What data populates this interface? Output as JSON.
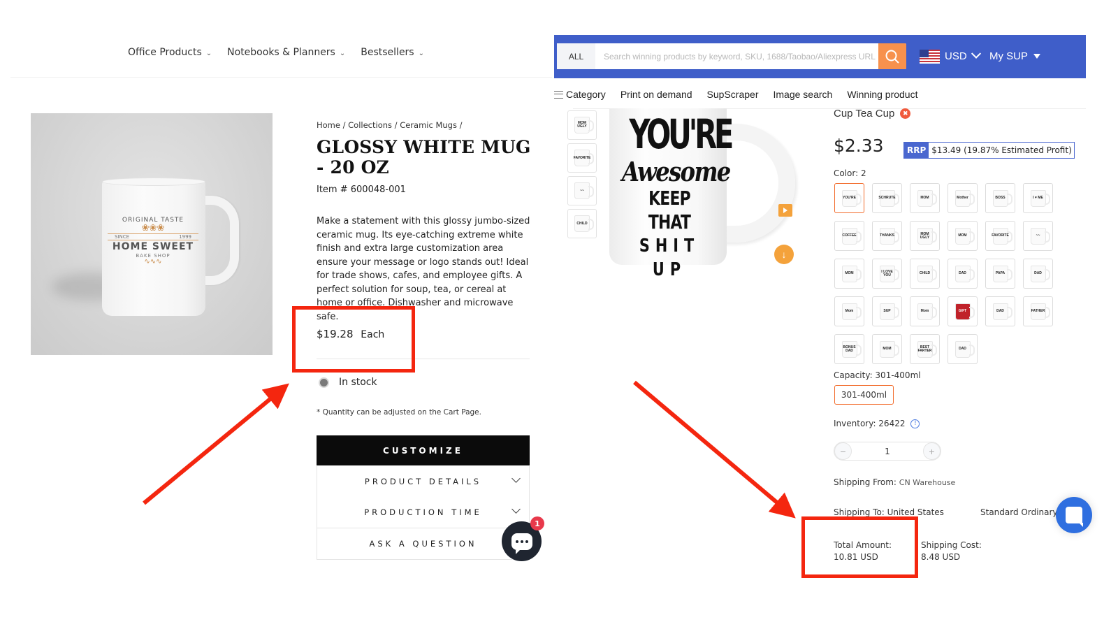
{
  "left_store": {
    "nav": [
      {
        "label": "Office Products"
      },
      {
        "label": "Notebooks & Planners"
      },
      {
        "label": "Bestsellers"
      }
    ],
    "hero_image": {
      "alt": "White mug with Home Sweet bake shop logo",
      "logo_top": "ORIGINAL TASTE",
      "logo_since": "SINCE",
      "logo_year": "1999",
      "logo_main": "HOME SWEET",
      "logo_sub": "BAKE SHOP"
    },
    "breadcrumb": "Home / Collections / Ceramic Mugs /",
    "title": "GLOSSY WHITE MUG - 20 OZ",
    "item_number": "Item # 600048-001",
    "description": "Make a statement with this glossy jumbo-sized ceramic mug. Its eye-catching extreme white finish and extra large customization area ensure your message or logo stands out! Ideal for trade shows, cafes, and employee gifts. A perfect solution for soup, tea, or cereal at home or office. Dishwasher and microwave safe.",
    "price": "$19.28",
    "price_unit": "Each",
    "stock_status": "In stock",
    "quantity_note": "* Quantity can be adjusted on the Cart Page.",
    "customize_label": "CUSTOMIZE",
    "accordions": [
      {
        "label": "PRODUCT DETAILS"
      },
      {
        "label": "PRODUCTION TIME"
      },
      {
        "label": "ASK A QUESTION"
      }
    ],
    "chat_badge_count": "1"
  },
  "supplier": {
    "search": {
      "scope": "ALL",
      "placeholder": "Search winning products by keyword, SKU, 1688/Taobao/Aliexpress URL",
      "value": ""
    },
    "currency": "USD",
    "account_menu": "My SUP",
    "nav": [
      {
        "label": "Category"
      },
      {
        "label": "Print on demand"
      },
      {
        "label": "SupScraper"
      },
      {
        "label": "Image search"
      },
      {
        "label": "Winning product"
      }
    ],
    "thumbnails": [
      {
        "text": "MOM UGLY"
      },
      {
        "text": "FAVORITE"
      },
      {
        "text": "~~"
      },
      {
        "text": "CHILD"
      }
    ],
    "main_image_text": {
      "line1": "YOU'RE",
      "line2": "Awesome",
      "line3": "KEEP THAT",
      "line4": "SHIT UP"
    },
    "product_title": "Cup Tea Cup",
    "price": "$2.33",
    "rrp_tag": "RRP",
    "rrp_value": "$13.49 (19.87% Estimated Profit)",
    "color_label": "Color: 2",
    "color_swatches": [
      {
        "text": "YOU'RE",
        "selected": true
      },
      {
        "text": "SCHRUTE"
      },
      {
        "text": "MOM"
      },
      {
        "text": "Mother"
      },
      {
        "text": "BOSS"
      },
      {
        "text": "I ♥ ME"
      },
      {
        "text": "COFFEE"
      },
      {
        "text": "THANKS"
      },
      {
        "text": "MOM UGLY"
      },
      {
        "text": "MOM"
      },
      {
        "text": "FAVORITE"
      },
      {
        "text": "~~"
      },
      {
        "text": "MOM"
      },
      {
        "text": "I LOVE YOU"
      },
      {
        "text": "CHILD"
      },
      {
        "text": "DAD"
      },
      {
        "text": "PAPA"
      },
      {
        "text": "DAD"
      },
      {
        "text": "Mom"
      },
      {
        "text": "SUP"
      },
      {
        "text": "Mom"
      },
      {
        "text": "GIFT",
        "red": true
      },
      {
        "text": "DAD"
      },
      {
        "text": "FATHER"
      },
      {
        "text": "BONUS DAD"
      },
      {
        "text": "MOM"
      },
      {
        "text": "BEST FARTER"
      },
      {
        "text": "DAD"
      }
    ],
    "capacity_label": "Capacity: 301-400ml",
    "capacity_option": "301-400ml",
    "inventory_label": "Inventory: 26422",
    "quantity": "1",
    "shipping_from_label": "Shipping From:",
    "shipping_from_value": "CN Warehouse",
    "shipping_to": "Shipping To: United States",
    "shipping_method": "Standard Ordinary",
    "total_amount_label": "Total Amount:",
    "total_amount_value": "10.81 USD",
    "shipping_cost_label": "Shipping Cost:",
    "shipping_cost_value": "8.48 USD"
  },
  "annotations": {
    "color": "#f4260f"
  }
}
